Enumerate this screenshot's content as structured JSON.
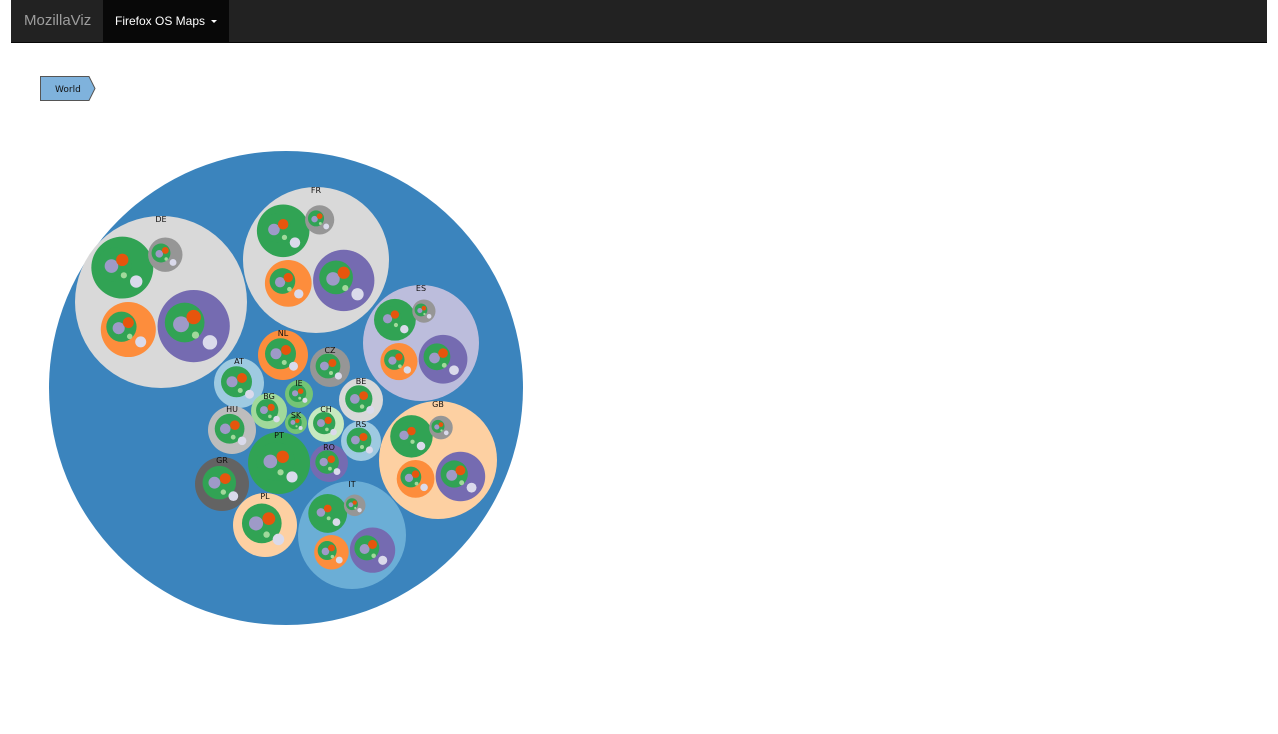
{
  "navbar": {
    "brand": "MozillaViz",
    "active_menu": "Firefox OS Maps"
  },
  "breadcrumb": {
    "items": [
      "World"
    ],
    "color": "#7fb2dc"
  },
  "chart_data": {
    "type": "packed-circles",
    "root": {
      "name": "World",
      "color": "#3b84bd"
    },
    "countries": [
      {
        "name": "DE",
        "color": "#d9d9d9"
      },
      {
        "name": "FR",
        "color": "#d9d9d9"
      },
      {
        "name": "ES",
        "color": "#bcbddc"
      },
      {
        "name": "NL",
        "color": "#fd8d3c"
      },
      {
        "name": "AT",
        "color": "#9ecae1"
      },
      {
        "name": "CZ",
        "color": "#969696"
      },
      {
        "name": "IE",
        "color": "#74c476"
      },
      {
        "name": "BE",
        "color": "#d9d9d9"
      },
      {
        "name": "BG",
        "color": "#a1d99b"
      },
      {
        "name": "SK",
        "color": "#74c476"
      },
      {
        "name": "CH",
        "color": "#c7e9c0"
      },
      {
        "name": "HU",
        "color": "#bdbdbd"
      },
      {
        "name": "RS",
        "color": "#9ecae1"
      },
      {
        "name": "GB",
        "color": "#fdd0a2"
      },
      {
        "name": "PT",
        "color": "#31a354"
      },
      {
        "name": "RO",
        "color": "#756bb1"
      },
      {
        "name": "GR",
        "color": "#636363"
      },
      {
        "name": "PL",
        "color": "#fdd0a2"
      },
      {
        "name": "IT",
        "color": "#6baed6"
      }
    ],
    "palette": {
      "green": "#31a354",
      "red_orange": "#e6550d",
      "purple": "#9e9ac8",
      "light_green": "#a1d99b",
      "light": "#dadaeb"
    }
  }
}
